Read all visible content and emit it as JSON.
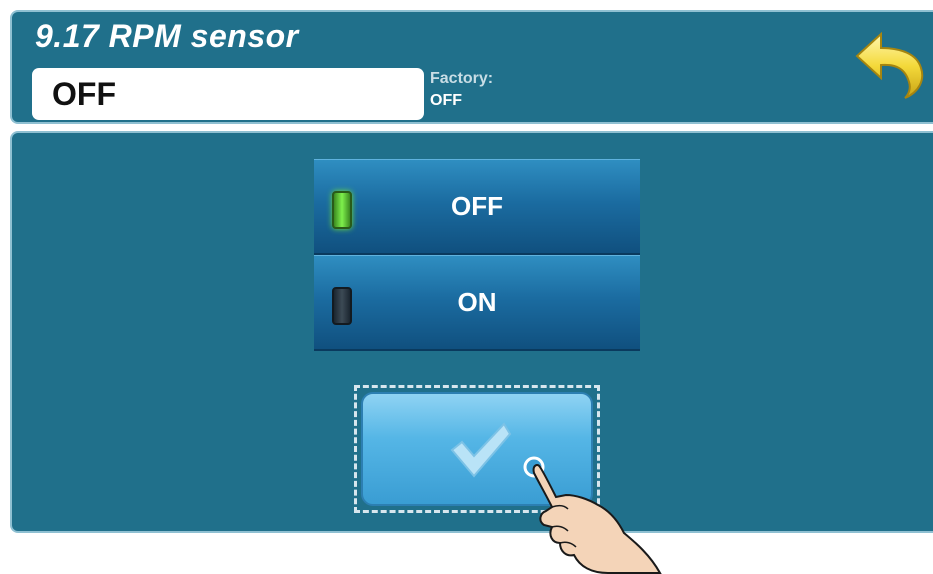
{
  "header": {
    "title": "9.17 RPM sensor",
    "current_value": "OFF",
    "factory_label": "Factory:",
    "factory_value": "OFF",
    "back_icon": "back-arrow-icon"
  },
  "options": [
    {
      "label": "OFF",
      "selected": true,
      "indicator": "led-on"
    },
    {
      "label": "ON",
      "selected": false,
      "indicator": "led-off"
    }
  ],
  "confirm": {
    "icon": "checkmark-icon"
  },
  "overlay": {
    "icon": "pointing-hand-icon"
  },
  "colors": {
    "panel_bg": "#20708b",
    "panel_border": "#8fc0d2",
    "option_bg": "#1b6ca1",
    "confirm_bg": "#55b6e6",
    "led_on": "#7ef04c",
    "back_arrow": "#f4d93a"
  }
}
